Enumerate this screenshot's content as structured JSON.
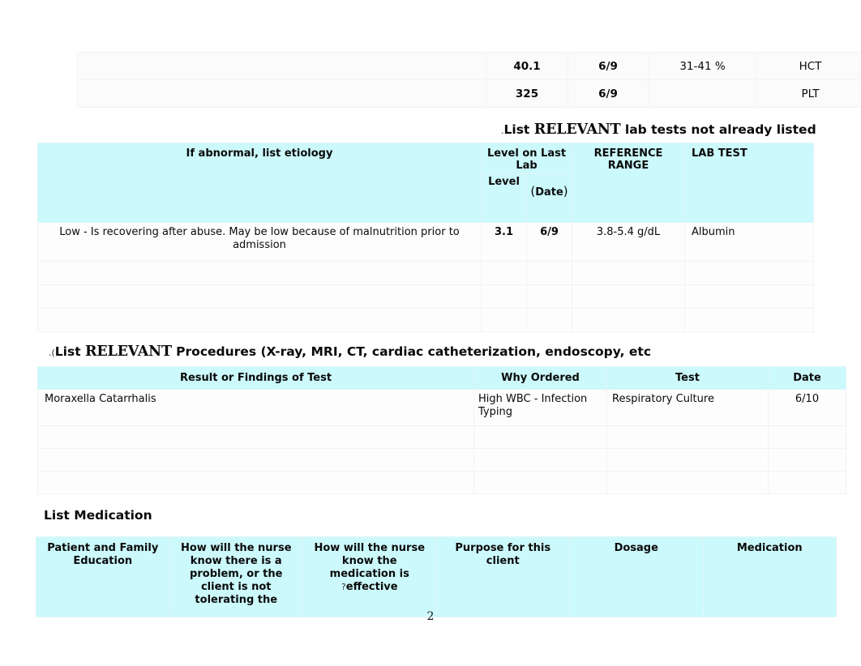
{
  "document": {
    "page_number": "2",
    "accent_header_color": "#ccf9fb"
  },
  "top_lab_table_continued": {
    "columns": [
      "If abnormal, list etiology",
      "Level",
      "(Date)",
      "REFERENCE RANGE",
      "LAB TEST"
    ],
    "rows": [
      {
        "etiology": "",
        "level": "40.1",
        "date": "6/9",
        "range": "31-41 %",
        "test": "HCT"
      },
      {
        "etiology": "",
        "level": "325",
        "date": "6/9",
        "range": "",
        "test": "PLT"
      }
    ]
  },
  "lab_section": {
    "heading": {
      "lead": ".",
      "before": "List ",
      "emphasis": "RELEVANT",
      "after": " lab tests not already listed"
    },
    "headers": {
      "etiology": "If abnormal, list etiology",
      "level_on_last_lab": "Level on Last Lab",
      "level": "Level",
      "date_open_paren": "(",
      "date": "Date",
      "date_close_paren": ")",
      "reference_range": "REFERENCE RANGE",
      "lab_test": "LAB TEST"
    },
    "rows": [
      {
        "etiology": "Low - Is recovering after abuse. May be low because of malnutrition prior to admission",
        "level": "3.1",
        "date": "6/9",
        "range": "3.8-5.4 g/dL",
        "test": "Albumin"
      },
      {
        "etiology": "",
        "level": "",
        "date": "",
        "range": "",
        "test": ""
      },
      {
        "etiology": "",
        "level": "",
        "date": "",
        "range": "",
        "test": ""
      },
      {
        "etiology": "",
        "level": "",
        "date": "",
        "range": "",
        "test": ""
      }
    ]
  },
  "procedures_section": {
    "heading": {
      "lead": ".(",
      "before": "List ",
      "emphasis": "RELEVANT",
      "after": " Procedures  (X-ray, MRI, CT, cardiac catheterization, endoscopy, etc"
    },
    "headers": {
      "result": "Result or Findings of Test",
      "why_ordered": "Why Ordered",
      "test": "Test",
      "date": "Date"
    },
    "rows": [
      {
        "result": "Moraxella Catarrhalis",
        "why_ordered": "High WBC - Infection Typing",
        "test": "Respiratory Culture",
        "date": "6/10"
      },
      {
        "result": "",
        "why_ordered": "",
        "test": "",
        "date": ""
      },
      {
        "result": "",
        "why_ordered": "",
        "test": "",
        "date": ""
      },
      {
        "result": "",
        "why_ordered": "",
        "test": "",
        "date": ""
      }
    ]
  },
  "medication_section": {
    "heading": "List Medication",
    "headers": {
      "patient_family_education": "Patient and Family Education",
      "problem_detection": "How will the nurse know there is a problem, or the client is not tolerating the",
      "effectiveness_lead": "?",
      "effectiveness": "How will the nurse know the medication is effective",
      "effectiveness_line1": "How will the nurse",
      "effectiveness_line2": "know the",
      "effectiveness_line3": "medication is",
      "effectiveness_line4": "effective",
      "purpose": "Purpose for this client",
      "dosage": "Dosage",
      "medication": "Medication"
    }
  }
}
